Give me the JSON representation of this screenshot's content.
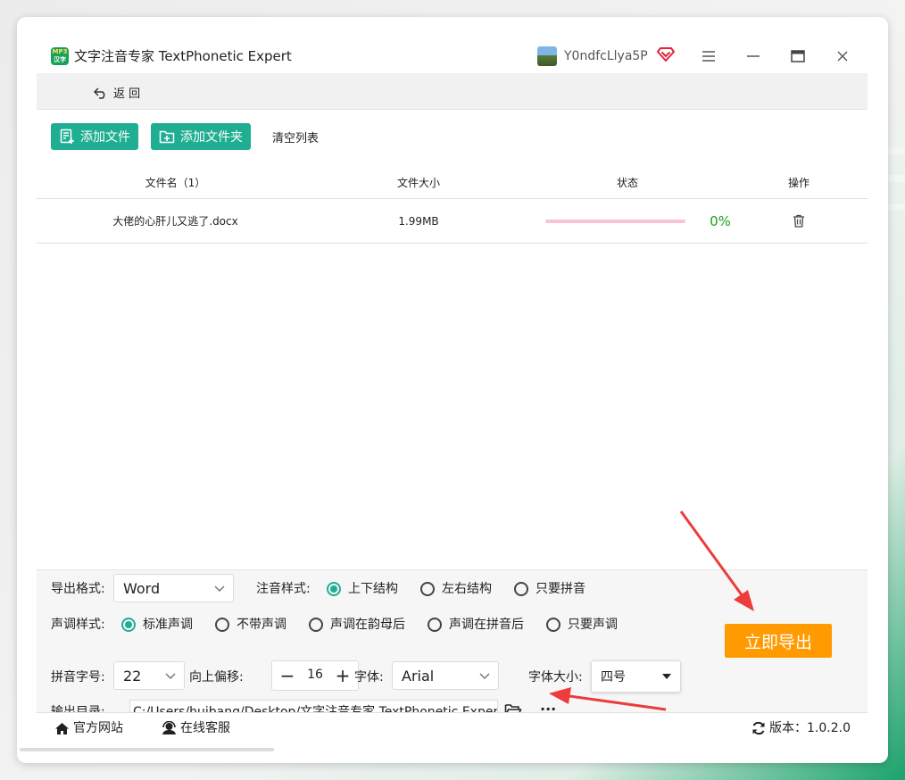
{
  "window": {
    "title": "文字注音专家 TextPhonetic Expert",
    "logo_text_top": "MP3",
    "logo_text_bottom": "汉字",
    "username": "Y0ndfcLlya5P"
  },
  "toolbar": {
    "back_label": "返 回"
  },
  "actions": {
    "add_file": "添加文件",
    "add_folder": "添加文件夹",
    "clear_list": "清空列表"
  },
  "grid": {
    "headers": {
      "name": "文件名（1）",
      "size": "文件大小",
      "status": "状态",
      "action": "操作"
    },
    "rows": [
      {
        "name": "大佬的心肝儿又逃了.docx",
        "size": "1.99MB",
        "progress": 0,
        "progress_label": "0%"
      }
    ]
  },
  "settings": {
    "format_label": "导出格式:",
    "format_value": "Word",
    "phonetic_style_label": "注音样式:",
    "phonetic_styles": [
      "上下结构",
      "左右结构",
      "只要拼音"
    ],
    "phonetic_style_selected": 0,
    "tone_style_label": "声调样式:",
    "tone_styles": [
      "标准声调",
      "不带声调",
      "声调在韵母后",
      "声调在拼音后",
      "只要声调"
    ],
    "tone_style_selected": 0,
    "pinyin_size_label": "拼音字号:",
    "pinyin_size_value": "22",
    "offset_label": "向上偏移:",
    "offset_value": "16",
    "font_label": "字体:",
    "font_value": "Arial",
    "font_size_label": "字体大小:",
    "font_size_value": "四号",
    "output_dir_label": "输出目录:",
    "output_dir_value": "C:/Users/huibang/Desktop/文字注音专家 TextPhonetic Expert",
    "more_label": "···"
  },
  "export_button": "立即导出",
  "footer": {
    "website": "官方网站",
    "support": "在线客服",
    "version": "版本：1.0.2.0"
  },
  "colors": {
    "accent": "#1fae92",
    "export": "#ff9b00",
    "progress_track": "#f9c4d2",
    "percent": "#18a018"
  }
}
